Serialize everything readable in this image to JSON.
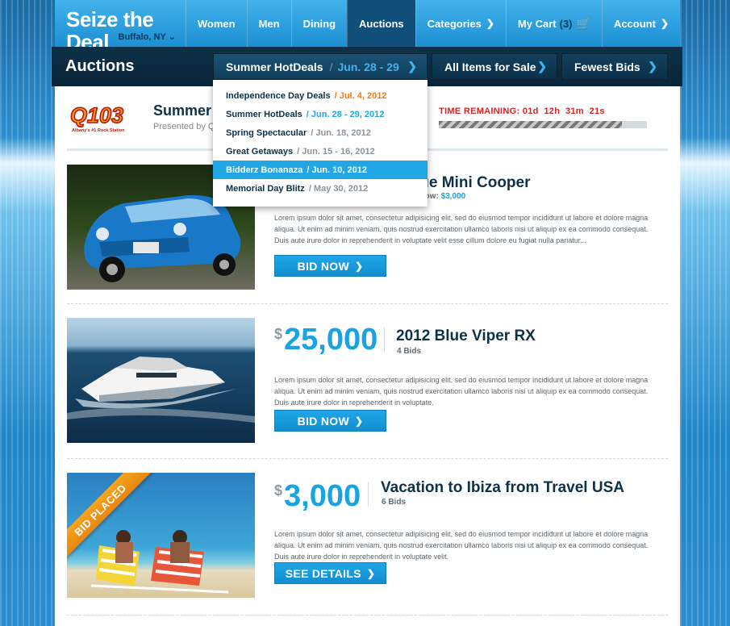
{
  "brand": {
    "title": "Seize the Deal",
    "city": "Buffalo, NY ⌄"
  },
  "nav": [
    {
      "label": "Women"
    },
    {
      "label": "Men"
    },
    {
      "label": "Dining"
    },
    {
      "label": "Auctions"
    },
    {
      "label": "Categories"
    },
    {
      "label": "My Cart",
      "count": "(3)"
    },
    {
      "label": "Account"
    }
  ],
  "subbar": {
    "title": "Auctions",
    "event_label": "Summer HotDeals",
    "event_sep": "/",
    "event_date": "Jun. 28 - 29",
    "items_filter": "All Items for Sale",
    "sort_filter": "Fewest Bids"
  },
  "sponsor": {
    "logo_text": "Q103",
    "logo_tagline": "Albany's #1 Rock Station",
    "name": "Summer",
    "presented_by": "Presented by Q1"
  },
  "countdown": {
    "label": "TIME REMAINING:",
    "value": "01d  12h  31m  21s",
    "progress": 0.88
  },
  "dropdown_menu": [
    {
      "name": "Independence Day Deals",
      "date": "/ Jul. 4, 2012",
      "style": "orange"
    },
    {
      "name": "Summer HotDeals",
      "date": "/ Jun. 28 - 29, 2012",
      "style": "blue"
    },
    {
      "name": "Spring Spectacular",
      "date": "/ Jun. 18, 2012",
      "style": "gray"
    },
    {
      "name": "Great Getaways",
      "date": "/ Jun. 15 - 16, 2012",
      "style": "gray"
    },
    {
      "name": "Bidderz Bonanaza",
      "date": "/ Jun. 10, 2012",
      "style": "selected"
    },
    {
      "name": "Memorial Day Blitz",
      "date": "/ May 30, 2012",
      "style": "gray"
    }
  ],
  "cards": [
    {
      "title": "lue Mini Cooper",
      "buy_now_label": "y Now:",
      "buy_now_price": "$3,000",
      "description": "Lorem ipsum dolor sit amet, consectetur adipisicing elit, sed do eiusmod tempor incididunt ut labore et dolore magna aliqua. Ut enim ad minim veniam, quis nostrud exercitation ullamco laboris nisi ut aliquip ex ea commodo consequat. Duis aute irure dolor in reprehenderit in voluptate velit esse cillum dolore eu fugiat nulla pariatur...",
      "button": "BID NOW"
    },
    {
      "currency": "$",
      "price": "25,000",
      "title": "2012 Blue Viper RX",
      "bids": "4 Bids",
      "description": "Lorem ipsum dolor sit amet, consectetur adipisicing elit, sed do eiusmod tempor incididunt ut labore et dolore magna aliqua. Ut enim ad minim veniam, quis nostrud exercitation ullamco laboris nisi ut aliquip ex ea commodo consequat. Duis aute irure dolor in reprehenderit in voluptate.",
      "button": "BID NOW"
    },
    {
      "currency": "$",
      "price": "3,000",
      "title": "Vacation to Ibiza from Travel USA",
      "bids": "6 Bids",
      "ribbon": "BID PLACED",
      "description": "Lorem ipsum dolor sit amet, consectetur adipisicing elit, sed do eiusmod tempor incididunt ut labore et dolore magna aliqua. Ut enim ad minim veniam, quis nostrud exercitation ullamco laboris nisi ut aliquip ex ea commodo consequat. Duis aute irure dolor in reprehenderit in voluptate velit.",
      "button": "SEE DETAILS"
    }
  ],
  "colors": {
    "accent": "#18a3e4",
    "nav_bg": "#1c8fd2",
    "subbar_bg": "#0d3148",
    "countdown": "#d72424",
    "ribbon": "#f08c14"
  },
  "icons": {
    "chevron": "chevron-down-icon",
    "cart": "cart-icon",
    "arrow": "chevron-right-icon"
  }
}
